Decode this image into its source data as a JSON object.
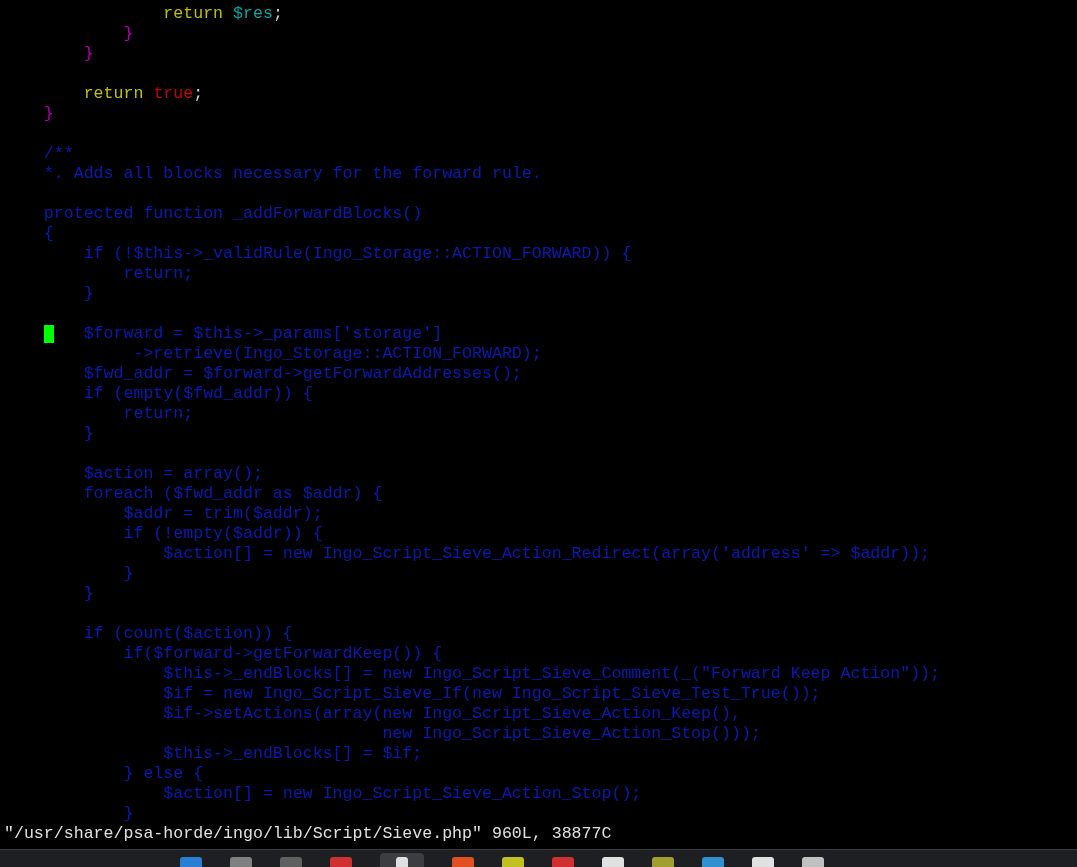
{
  "editor": {
    "blocks": [
      {
        "lines": [
          {
            "segments": [
              {
                "text": "                return",
                "kind": "keyword"
              },
              {
                "text": " $res",
                "kind": "variable"
              },
              {
                "text": ";",
                "kind": "plain"
              }
            ]
          },
          {
            "segments": [
              {
                "text": "            }",
                "kind": "brace"
              }
            ]
          },
          {
            "segments": [
              {
                "text": "        }",
                "kind": "brace"
              }
            ]
          }
        ]
      },
      {
        "lines": [
          {
            "segments": [
              {
                "text": "        return",
                "kind": "keyword"
              },
              {
                "text": " true",
                "kind": "constant"
              },
              {
                "text": ";",
                "kind": "plain"
              }
            ]
          },
          {
            "segments": [
              {
                "text": "    }",
                "kind": "brace"
              }
            ]
          }
        ]
      },
      {
        "lines": [
          {
            "segments": [
              {
                "text": "    /**",
                "kind": "comment"
              }
            ]
          },
          {
            "segments": [
              {
                "text": "    *. Adds all blocks necessary for the forward rule.",
                "kind": "comment"
              }
            ]
          }
        ]
      },
      {
        "lines": [
          {
            "segments": [
              {
                "text": "    protected function _addForwardBlocks()",
                "kind": "comment"
              }
            ]
          },
          {
            "segments": [
              {
                "text": "    {",
                "kind": "comment"
              }
            ]
          },
          {
            "segments": [
              {
                "text": "        if (!$this->_validRule(Ingo_Storage::ACTION_FORWARD)) {",
                "kind": "comment"
              }
            ]
          },
          {
            "segments": [
              {
                "text": "            return;",
                "kind": "comment"
              }
            ]
          },
          {
            "segments": [
              {
                "text": "        }",
                "kind": "comment"
              }
            ]
          }
        ]
      },
      {
        "lines": [
          {
            "cursor": true,
            "segments": [
              {
                "text": "        $forward = $this->_params['storage']",
                "kind": "comment"
              }
            ]
          },
          {
            "segments": [
              {
                "text": "             ->retrieve(Ingo_Storage::ACTION_FORWARD);",
                "kind": "comment"
              }
            ]
          },
          {
            "segments": [
              {
                "text": "        $fwd_addr = $forward->getForwardAddresses();",
                "kind": "comment"
              }
            ]
          },
          {
            "segments": [
              {
                "text": "        if (empty($fwd_addr)) {",
                "kind": "comment"
              }
            ]
          },
          {
            "segments": [
              {
                "text": "            return;",
                "kind": "comment"
              }
            ]
          },
          {
            "segments": [
              {
                "text": "        }",
                "kind": "comment"
              }
            ]
          }
        ]
      },
      {
        "lines": [
          {
            "segments": [
              {
                "text": "        $action = array();",
                "kind": "comment"
              }
            ]
          },
          {
            "segments": [
              {
                "text": "        foreach ($fwd_addr as $addr) {",
                "kind": "comment"
              }
            ]
          },
          {
            "segments": [
              {
                "text": "            $addr = trim($addr);",
                "kind": "comment"
              }
            ]
          },
          {
            "segments": [
              {
                "text": "            if (!empty($addr)) {",
                "kind": "comment"
              }
            ]
          },
          {
            "segments": [
              {
                "text": "                $action[] = new Ingo_Script_Sieve_Action_Redirect(array('address' => $addr));",
                "kind": "comment"
              }
            ]
          },
          {
            "segments": [
              {
                "text": "            }",
                "kind": "comment"
              }
            ]
          },
          {
            "segments": [
              {
                "text": "        }",
                "kind": "comment"
              }
            ]
          }
        ]
      },
      {
        "lines": [
          {
            "segments": [
              {
                "text": "        if (count($action)) {",
                "kind": "comment"
              }
            ]
          },
          {
            "segments": [
              {
                "text": "            if($forward->getForwardKeep()) {",
                "kind": "comment"
              }
            ]
          },
          {
            "segments": [
              {
                "text": "                $this->_endBlocks[] = new Ingo_Script_Sieve_Comment(_(\"Forward Keep Action\"));",
                "kind": "comment"
              }
            ]
          },
          {
            "segments": [
              {
                "text": "                $if = new Ingo_Script_Sieve_If(new Ingo_Script_Sieve_Test_True());",
                "kind": "comment"
              }
            ]
          },
          {
            "segments": [
              {
                "text": "                $if->setActions(array(new Ingo_Script_Sieve_Action_Keep(),",
                "kind": "comment"
              }
            ]
          },
          {
            "segments": [
              {
                "text": "                                      new Ingo_Script_Sieve_Action_Stop()));",
                "kind": "comment"
              }
            ]
          },
          {
            "segments": [
              {
                "text": "                $this->_endBlocks[] = $if;",
                "kind": "comment"
              }
            ]
          },
          {
            "segments": [
              {
                "text": "            } else {",
                "kind": "comment"
              }
            ]
          },
          {
            "segments": [
              {
                "text": "                $action[] = new Ingo_Script_Sieve_Action_Stop();",
                "kind": "comment"
              }
            ]
          },
          {
            "segments": [
              {
                "text": "            }",
                "kind": "comment"
              }
            ]
          }
        ]
      }
    ]
  },
  "status_line": "\"/usr/share/psa-horde/ingo/lib/Script/Sieve.php\" 960L, 38877C"
}
